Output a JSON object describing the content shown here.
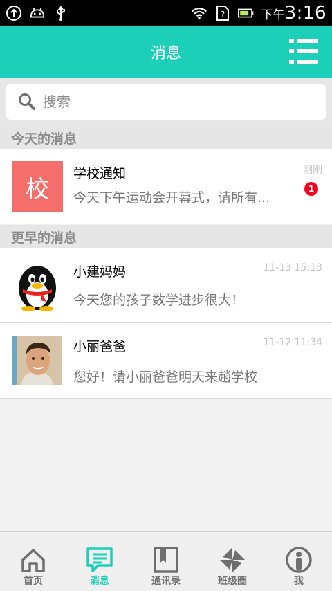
{
  "status_bar": {
    "time_prefix": "下午",
    "time": "3:16",
    "icons": [
      "upload-icon",
      "android-icon",
      "usb-icon",
      "wifi-icon",
      "sim-unknown-icon",
      "battery-icon"
    ]
  },
  "header": {
    "title": "消息",
    "menu_icon": "list-menu-icon"
  },
  "search": {
    "placeholder": "搜索"
  },
  "sections": [
    {
      "title": "今天的消息",
      "messages": [
        {
          "avatar_text": "校",
          "name": "学校通知",
          "preview": "今天下午运动会开幕式，请所有...",
          "time": "刚刚",
          "unread": "1"
        }
      ]
    },
    {
      "title": "更早的消息",
      "messages": [
        {
          "avatar": "qq-penguin-avatar",
          "name": "小建妈妈",
          "preview": "今天您的孩子数学进步很大！",
          "time": "11-13 15:13"
        },
        {
          "avatar": "man-photo-avatar",
          "name": "小丽爸爸",
          "preview": "您好！请小丽爸爸明天来趟学校",
          "time": "11-12 11:34"
        }
      ]
    }
  ],
  "tabs": [
    {
      "label": "首页",
      "icon": "home-icon"
    },
    {
      "label": "消息",
      "icon": "chat-icon",
      "active": true
    },
    {
      "label": "通讯录",
      "icon": "contacts-icon"
    },
    {
      "label": "班级圈",
      "icon": "pinwheel-icon"
    },
    {
      "label": "我",
      "icon": "person-icon"
    }
  ],
  "colors": {
    "accent": "#1ccfb9",
    "badge": "#f5001c",
    "avatar_school": "#f46e6c"
  }
}
